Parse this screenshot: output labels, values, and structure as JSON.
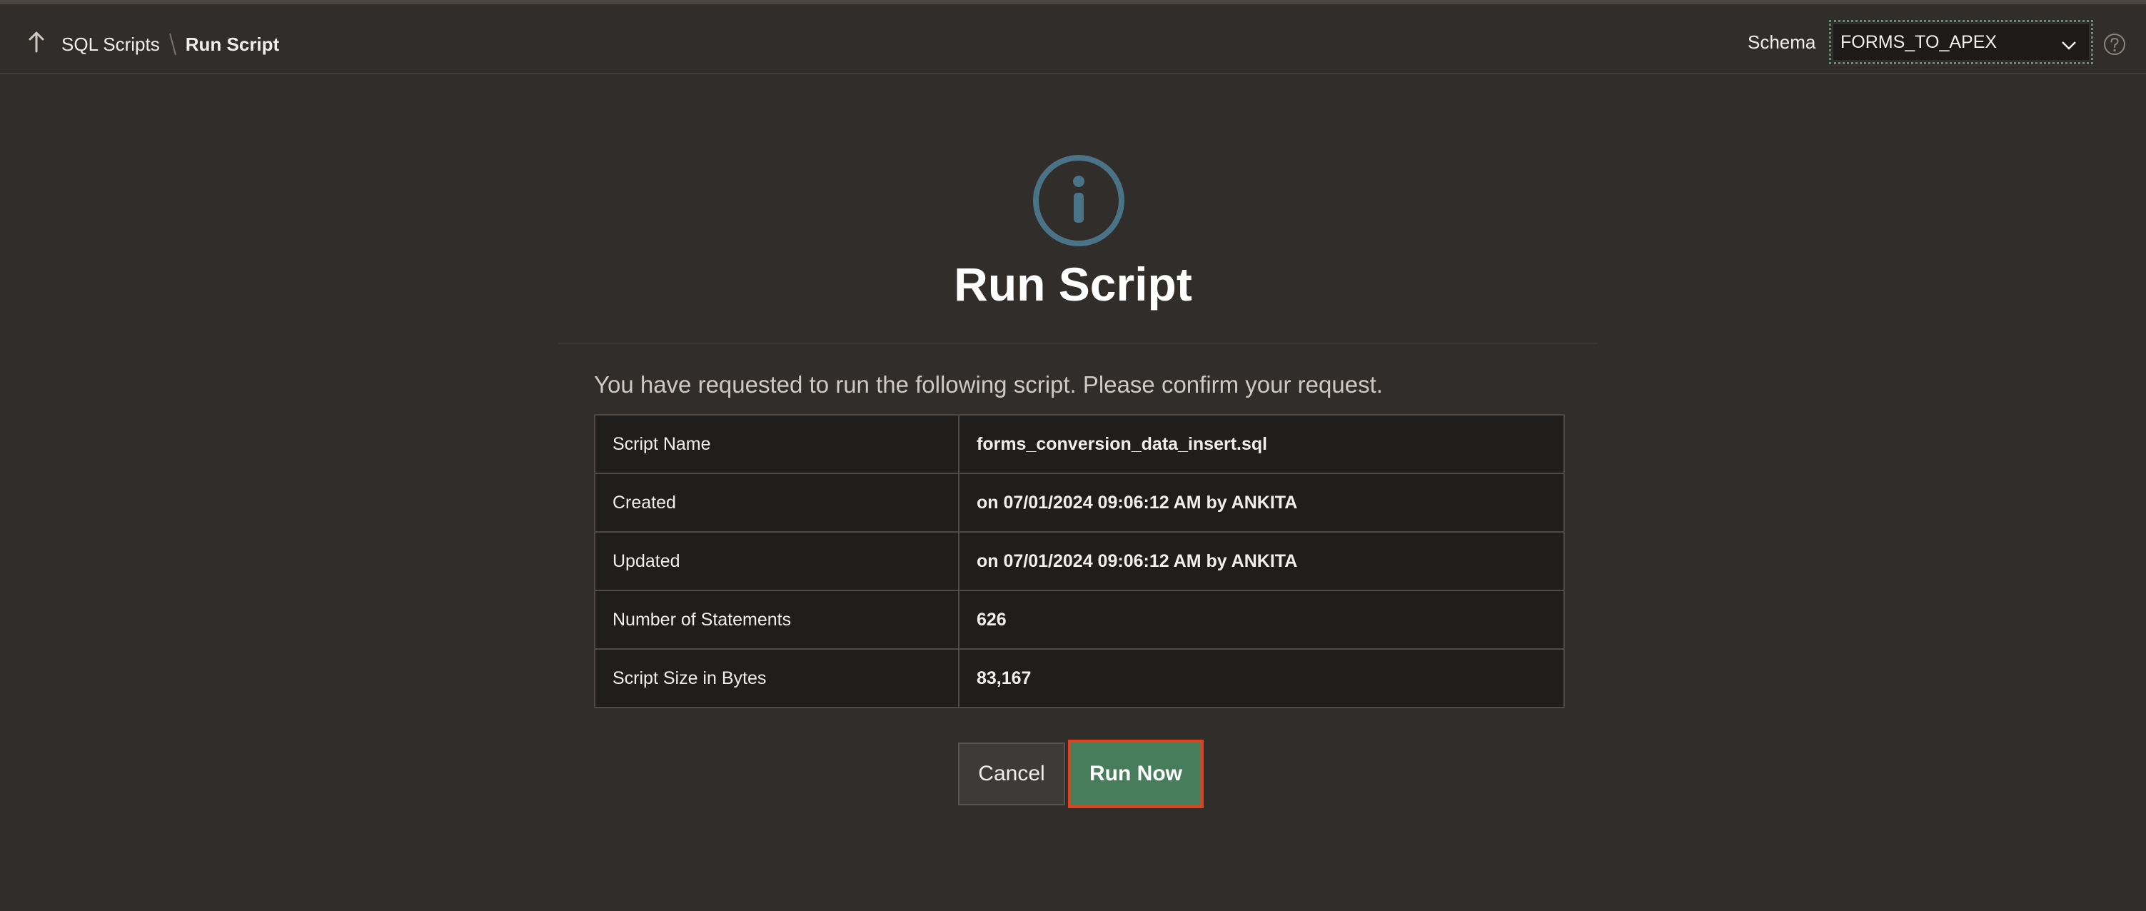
{
  "breadcrumb": {
    "parent_label": "SQL Scripts",
    "current_label": "Run Script"
  },
  "schema": {
    "label": "Schema",
    "selected": "FORMS_TO_APEX"
  },
  "page": {
    "title": "Run Script",
    "intro": "You have requested to run the following script. Please confirm your request."
  },
  "details": [
    {
      "key": "Script Name",
      "value": "forms_conversion_data_insert.sql"
    },
    {
      "key": "Created",
      "value": "on 07/01/2024 09:06:12 AM by ANKITA"
    },
    {
      "key": "Updated",
      "value": "on 07/01/2024 09:06:12 AM by ANKITA"
    },
    {
      "key": "Number of Statements",
      "value": "626"
    },
    {
      "key": "Script Size in Bytes",
      "value": "83,167"
    }
  ],
  "actions": {
    "cancel_label": "Cancel",
    "run_label": "Run Now"
  },
  "icons": {
    "up": "arrow-up-icon",
    "info": "info-icon",
    "help": "help-icon",
    "dropdown": "chevron-down-icon"
  },
  "colors": {
    "background": "#312d2a",
    "primary_button": "#487d5c",
    "focus_border": "#e0421f",
    "info_icon": "#4b7387"
  }
}
